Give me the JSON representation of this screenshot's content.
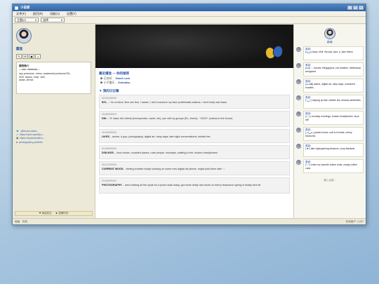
{
  "window": {
    "title": "小说家"
  },
  "menu": [
    "文件(F)",
    "首页(R)",
    "功能(A)",
    "设置(T)"
  ],
  "toolbar": {
    "view_select": "主题(E)",
    "sort_select": "选择"
  },
  "profile": {
    "username": "霸道",
    "bio_title": "我的简介",
    "bio_line1": "—user database—",
    "bio_line2": "any pronouns. minor, unplanned profound DK,",
    "bio_line3": "0/20. taurus. entp. 1w9,",
    "bio_line4": "asian, ctrncd",
    "links": [
      {
        "icon": "twitter-icon",
        "glyph": "🐦",
        "text": "@bloom.aaha..."
      },
      {
        "icon": "music-icon",
        "glyph": "♫",
        "text": "https://open.spotify.c..."
      },
      {
        "icon": "video-icon",
        "glyph": "▣",
        "text": "https://myanimelist.n..."
      },
      {
        "icon": "camera-icon",
        "glyph": "◘",
        "text": "photography.portfolio"
      }
    ],
    "footer": "❤ 添加关注 　 ★ 查看时光"
  },
  "recommend": {
    "title": "最近播放 — 你的推荐",
    "items": [
      {
        "prefix": "▶ 正在听 ...",
        "name": "Sweet Love"
      },
      {
        "prefix": "▶ 小于整天 ...",
        "name": "Kokoalso"
      }
    ]
  },
  "posts_title": "▼ 我的日记簿",
  "posts": [
    {
      "date": "2/1/21/2000/3",
      "label": "BYL",
      "text": "...: I'm a minor, time are fine, I swear, I don't condone my fave problematic actions, I don't bully user base"
    },
    {
      "date": "2/1/20/2000/3",
      "label": "DNI",
      "text": "...: R: basic dni criteria (homophobic, racist, etc), you will my groups (Ex, check), ~13/22+ (unless in the forum)"
    },
    {
      "date": "2/1/19/2000/3",
      "label": "LIKES",
      "text": "... anime, k-pop, photography, digital art, rainy days, late night conversations, bubble tea"
    },
    {
      "date": "2/1/18/2000/3",
      "label": "DISLIKES",
      "text": "... loud noises, crowded places, rude people, mondays, waiting in line, broken headphones"
    },
    {
      "date": "2/1/17/2000/3",
      "label": "CURRENT MOOD",
      "text": "... feeling creative today! working on some new digital art pieces. might post them later ♡"
    },
    {
      "date": "2/1/16/2000/3",
      "label": "PHOTOGRAPHY",
      "text": "... went visiting all the spots for a photo walk today, got some really nice shots of cherry blossoms! spring is finally here ✿"
    }
  ],
  "right": {
    "name": "霸道!",
    "items": [
      {
        "who": "霸道!",
        "text": "(◕‿◕) kpop, kfoll, rity pop, jazz, p. jazz fusion"
      },
      {
        "who": "霸道!",
        "text": "(•ω•) ♡ travels: blingappers, hot weather, intellectual arrogance"
      },
      {
        "who": "霸道!",
        "text": "(◕ᴗ◕✿) anime, digital art, rainy days, oversized hoodies"
      },
      {
        "who": "霸道!",
        "text": "(¬‿¬) staying up late, bubble tea, dreamy aesthetics"
      },
      {
        "who": "霸道!",
        "text": "(>_<) monday mornings, broken headphones, slow wifi"
      },
      {
        "who": "霸道!",
        "text": "(｡◕‿◕｡) pastel colors, soft lo-fi beats, cherry blossoms"
      },
      {
        "who": "霸道!",
        "text": "(ᵔᴥᵔ) late night gaming sessions, cozy blankets"
      },
      {
        "who": "霸道!",
        "text": "(^_^) when my favorite anime ends, empty coffee cups"
      }
    ],
    "more": "载入全部..."
  },
  "status": {
    "left": "就绪　完成",
    "right": "在线用户: 1,247"
  }
}
